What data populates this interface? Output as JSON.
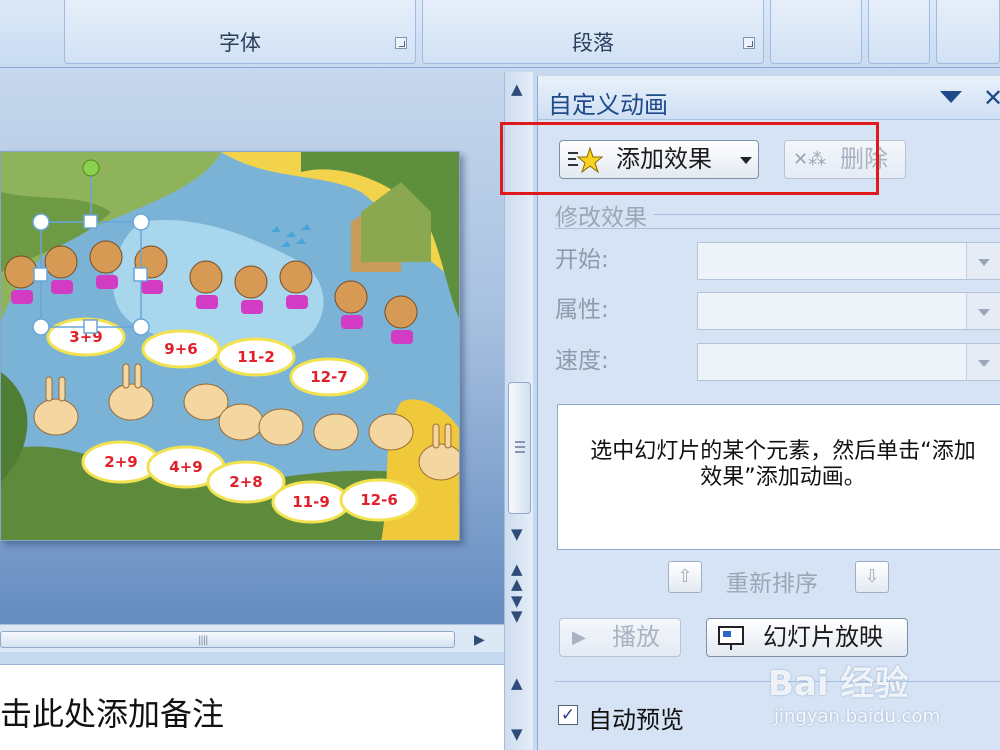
{
  "ribbon": {
    "font_group_label": "字体",
    "paragraph_group_label": "段落"
  },
  "notes": {
    "text": "击此处添加备注"
  },
  "task_pane": {
    "title": "自定义动画",
    "add_effect_label": "添加效果",
    "remove_label": "删除",
    "modify_section": "修改效果",
    "start_label": "开始:",
    "property_label": "属性:",
    "speed_label": "速度:",
    "info_text": "选中幻灯片的某个元素，然后单击“添加效果”添加动画。",
    "reorder_label": "重新排序",
    "play_label": "播放",
    "slideshow_label": "幻灯片放映",
    "autopreview_label": "自动预览",
    "autopreview_checked": true
  },
  "slide": {
    "labels": [
      "3+9",
      "9+6",
      "11-2",
      "12-7",
      "2+9",
      "4+9",
      "2+8",
      "11-9",
      "12-6"
    ]
  },
  "watermark": {
    "logo_text": "Bai 经验",
    "url": "jingyan.baidu.com"
  },
  "colors": {
    "highlight": "#e01a1a",
    "pane_title": "#1e4a8a",
    "math_text": "#e0202a"
  }
}
